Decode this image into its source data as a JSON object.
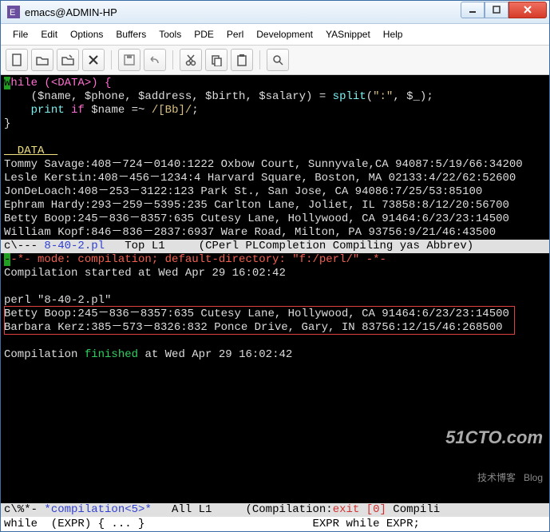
{
  "window": {
    "title": "emacs@ADMIN-HP"
  },
  "menu": {
    "items": [
      "File",
      "Edit",
      "Options",
      "Buffers",
      "Tools",
      "PDE",
      "Perl",
      "Development",
      "YASnippet",
      "Help"
    ]
  },
  "toolbar": {
    "icons": [
      "new",
      "open",
      "save-as",
      "close",
      "save",
      "undo",
      "cut",
      "copy",
      "paste",
      "search"
    ]
  },
  "code": {
    "l1a": "w",
    "l1b": "hile (<DATA>) {",
    "l2a": "    ($name, $phone, $address, $birth, $salary) = ",
    "l2b": "split",
    "l2c": "(",
    "l2d": "\":\"",
    "l2e": ", $_);",
    "l3a": "    ",
    "l3b": "print",
    "l3c": " ",
    "l3d": "if",
    "l3e": " $name =~ ",
    "l3f": "/[Bb]/",
    "l3g": ";",
    "l4": "}",
    "l5": "",
    "l6a": "__DATA__",
    "d1": "Tommy Savage:408－724－0140:1222 Oxbow Court, Sunnyvale,CA 94087:5/19/66:34200",
    "d2": "Lesle Kerstin:408－456－1234:4 Harvard Square, Boston, MA 02133:4/22/62:52600",
    "d3": "JonDeLoach:408－253－3122:123 Park St., San Jose, CA 94086:7/25/53:85100",
    "d4": "Ephram Hardy:293－259－5395:235 Carlton Lane, Joliet, IL 73858:8/12/20:56700",
    "d5": "Betty Boop:245－836－8357:635 Cutesy Lane, Hollywood, CA 91464:6/23/23:14500",
    "d6": "William Kopf:846－836－2837:6937 Ware Road, Milton, PA 93756:9/21/46:43500"
  },
  "modeline1": {
    "left": "c\\--- ",
    "file": "8-40-2.pl",
    "mid": "   Top L1     (CPerl PLCompletion Compiling yas Abbrev)"
  },
  "compile": {
    "c1": "-*- mode: compilation; default-directory: \"f:/perl/\" -*-",
    "c2": "Compilation started at Wed Apr 29 16:02:42",
    "c3": "",
    "c4": "perl \"8-40-2.pl\"",
    "r1": "Betty Boop:245－836－8357:635 Cutesy Lane, Hollywood, CA 91464:6/23/23:14500",
    "r2": "Barbara Kerz:385－573－8326:832 Ponce Drive, Gary, IN 83756:12/15/46:268500",
    "c5a": "Compilation ",
    "c5b": "finished",
    "c5c": " at Wed Apr 29 16:02:42"
  },
  "modeline2": {
    "left": "c\\%*- ",
    "buf": "*compilation<5>*",
    "mid": "   All L1     (Compilation:",
    "exit": "exit [0]",
    "rest": " Compili"
  },
  "minibuffer": {
    "text": "while  (EXPR) { ... }                         EXPR while EXPR;"
  },
  "watermark": {
    "big": "51CTO.com",
    "small": "技术博客   Blog"
  }
}
